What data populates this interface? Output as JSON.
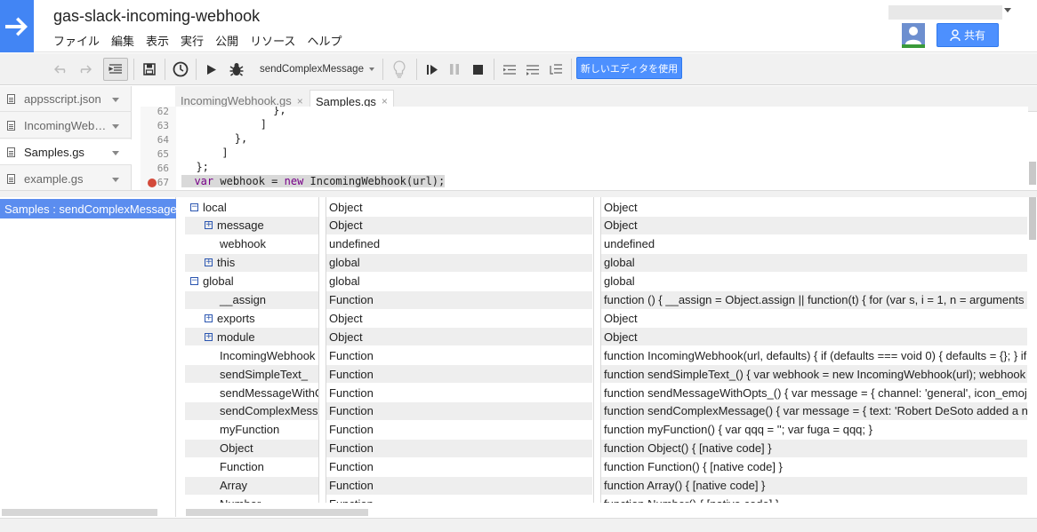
{
  "header": {
    "title": "gas-slack-incoming-webhook",
    "menu": [
      "ファイル",
      "編集",
      "表示",
      "実行",
      "公開",
      "リソース",
      "ヘルプ"
    ],
    "share_label": "共有"
  },
  "toolbar": {
    "function_select": "sendComplexMessage",
    "new_editor_label": "新しいエディタを使用"
  },
  "files": [
    {
      "name": "appsscript.json",
      "active": false
    },
    {
      "name": "IncomingWeb…",
      "active": false
    },
    {
      "name": "Samples.gs",
      "active": true
    },
    {
      "name": "example.gs",
      "active": false
    }
  ],
  "tabs": [
    {
      "label": "IncomingWebhook.gs",
      "close": "×"
    },
    {
      "label": "Samples.gs",
      "close": "×"
    }
  ],
  "code": {
    "lines": [
      {
        "no": "62",
        "text": "              },"
      },
      {
        "no": "63",
        "text": "            ]"
      },
      {
        "no": "64",
        "text": "        },"
      },
      {
        "no": "65",
        "text": "      ]"
      },
      {
        "no": "66",
        "text": "  };"
      },
      {
        "no": "67",
        "pre": "  ",
        "kw1": "var",
        "mid": " webhook = ",
        "kw2": "new",
        "post": " IncomingWebhook(url);"
      }
    ]
  },
  "callstack": {
    "frames": [
      "Samples : sendComplexMessage"
    ]
  },
  "variables": {
    "rows": [
      {
        "toggle": "⊟",
        "indent": 0,
        "name": "local",
        "type": "Object",
        "value": "Object"
      },
      {
        "toggle": "⊞",
        "indent": 1,
        "name": "message",
        "type": "Object",
        "value": "Object"
      },
      {
        "toggle": "",
        "indent": 1,
        "name": "webhook",
        "type": "undefined",
        "value": "undefined"
      },
      {
        "toggle": "⊞",
        "indent": 1,
        "name": "this",
        "type": "global",
        "value": "global"
      },
      {
        "toggle": "⊟",
        "indent": 0,
        "name": "global",
        "type": "global",
        "value": "global"
      },
      {
        "toggle": "",
        "indent": 1,
        "name": "__assign",
        "type": "Function",
        "value": "function () { __assign = Object.assign || function(t) { for (var s, i = 1, n = arguments"
      },
      {
        "toggle": "⊞",
        "indent": 1,
        "name": "exports",
        "type": "Object",
        "value": "Object"
      },
      {
        "toggle": "⊞",
        "indent": 1,
        "name": "module",
        "type": "Object",
        "value": "Object"
      },
      {
        "toggle": "",
        "indent": 1,
        "name": "IncomingWebhook",
        "type": "Function",
        "value": "function IncomingWebhook(url, defaults) { if (defaults === void 0) { defaults = {}; } if"
      },
      {
        "toggle": "",
        "indent": 1,
        "name": "sendSimpleText_",
        "type": "Function",
        "value": "function sendSimpleText_() { var webhook = new IncomingWebhook(url); webhook"
      },
      {
        "toggle": "",
        "indent": 1,
        "name": "sendMessageWithOpts_",
        "type": "Function",
        "value": "function sendMessageWithOpts_() { var message = { channel: 'general', icon_emoj"
      },
      {
        "toggle": "",
        "indent": 1,
        "name": "sendComplexMessage",
        "type": "Function",
        "value": "function sendComplexMessage() { var message = { text: 'Robert DeSoto added a n"
      },
      {
        "toggle": "",
        "indent": 1,
        "name": "myFunction",
        "type": "Function",
        "value": "function myFunction() { var qqq = ''; var fuga = qqq; }"
      },
      {
        "toggle": "",
        "indent": 1,
        "name": "Object",
        "type": "Function",
        "value": "function Object() { [native code] }"
      },
      {
        "toggle": "",
        "indent": 1,
        "name": "Function",
        "type": "Function",
        "value": "function Function() { [native code] }"
      },
      {
        "toggle": "",
        "indent": 1,
        "name": "Array",
        "type": "Function",
        "value": "function Array() { [native code] }"
      },
      {
        "toggle": "",
        "indent": 1,
        "name": "Number",
        "type": "Function",
        "value": "function Number() { [native code] }"
      }
    ]
  }
}
